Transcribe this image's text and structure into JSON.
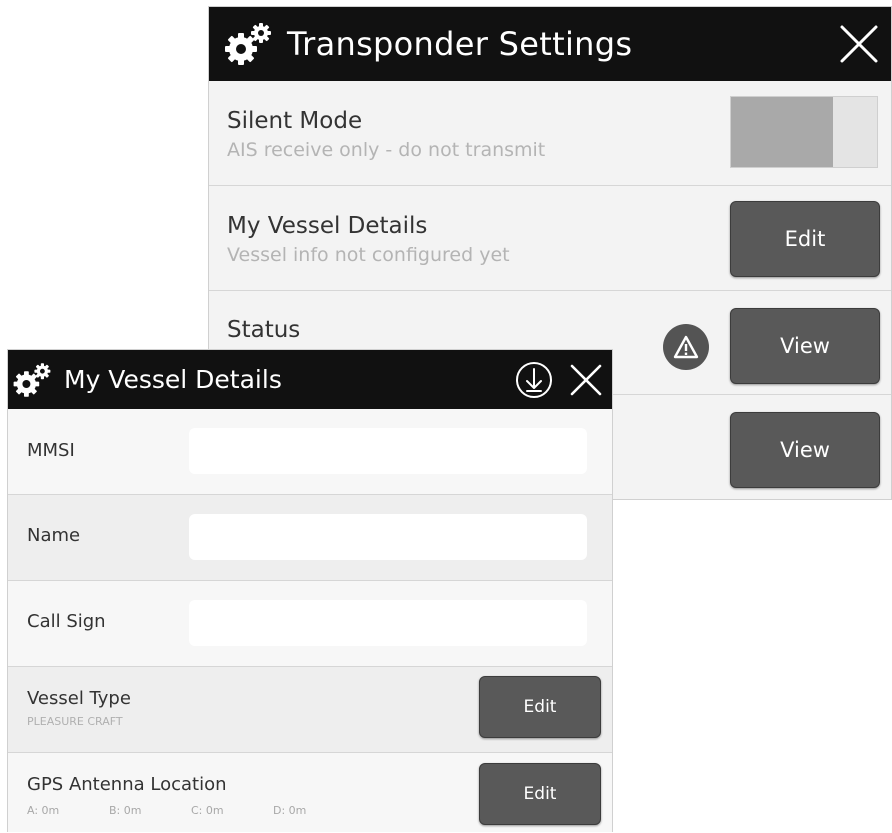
{
  "transponder": {
    "title": "Transponder Settings",
    "silent_mode": {
      "label": "Silent Mode",
      "sub": "AIS receive only - do not transmit",
      "enabled": false
    },
    "vessel_details": {
      "label": "My Vessel Details",
      "sub": "Vessel info not configured yet",
      "button": "Edit"
    },
    "status": {
      "label": "Status",
      "button": "View",
      "warning_icon": "warning-triangle-icon"
    },
    "row4": {
      "button": "View"
    }
  },
  "vessel": {
    "title": "My Vessel Details",
    "mmsi": {
      "label": "MMSI",
      "value": "",
      "placeholder": ""
    },
    "name": {
      "label": "Name",
      "value": "",
      "placeholder": ""
    },
    "call_sign": {
      "label": "Call Sign",
      "value": "",
      "placeholder": ""
    },
    "vessel_type": {
      "label": "Vessel Type",
      "sub": "PLEASURE CRAFT",
      "button": "Edit"
    },
    "gps": {
      "label": "GPS Antenna Location",
      "button": "Edit",
      "a": "A:  0m",
      "b": "B:  0m",
      "c": "C:  0m",
      "d": "D:  0m"
    }
  },
  "icons": {
    "gear": "gear-icon",
    "close": "close-icon",
    "save": "download-circle-icon"
  },
  "colors": {
    "header_bg": "#111111",
    "button_bg": "#595959",
    "toggle_fill": "#a9a9a9"
  }
}
